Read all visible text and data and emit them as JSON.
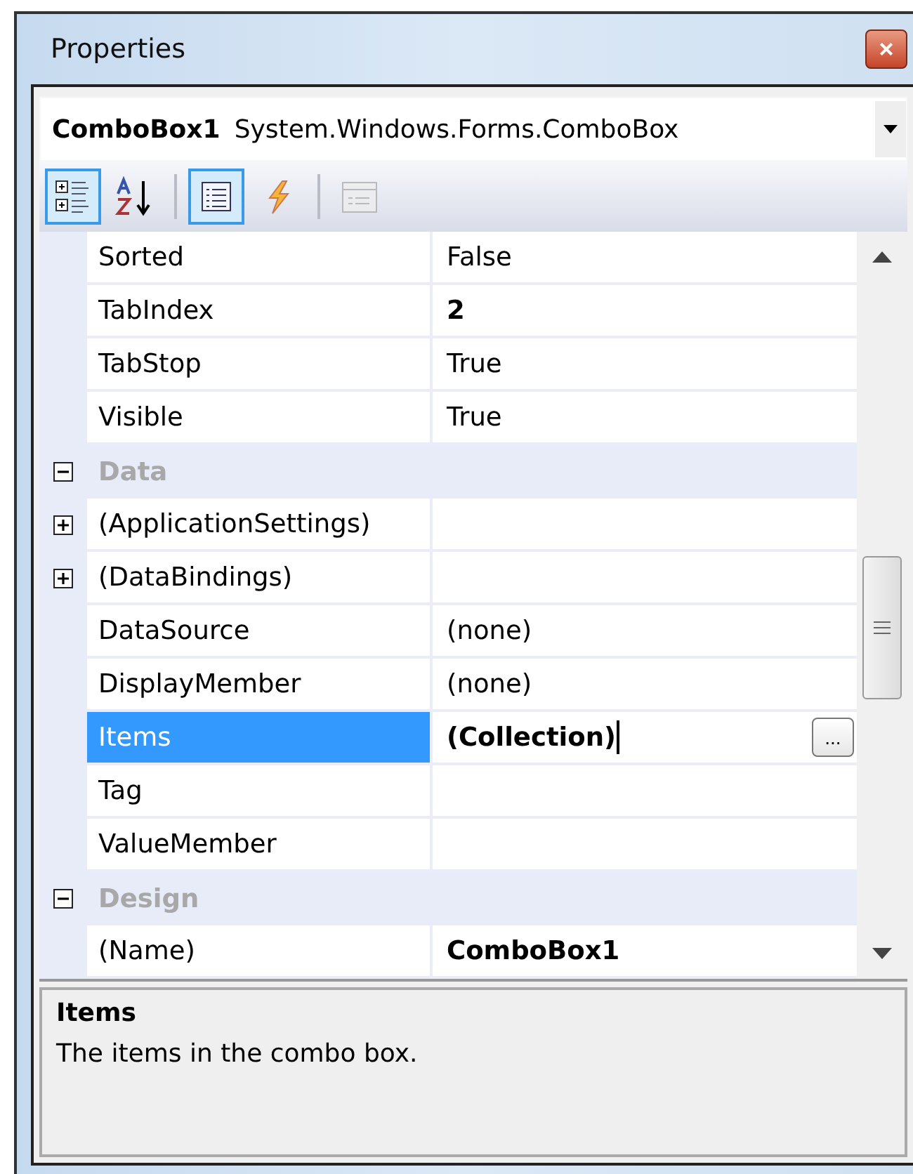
{
  "window": {
    "title": "Properties",
    "close": "×"
  },
  "object_selector": {
    "name": "ComboBox1",
    "type": "System.Windows.Forms.ComboBox"
  },
  "toolbar": [
    {
      "kind": "categorized",
      "selected": true,
      "disabled": false
    },
    {
      "kind": "alphabetical",
      "selected": false,
      "disabled": false
    },
    {
      "kind": "separator"
    },
    {
      "kind": "properties",
      "selected": true,
      "disabled": false
    },
    {
      "kind": "events",
      "selected": false,
      "disabled": false
    },
    {
      "kind": "separator"
    },
    {
      "kind": "property-pages",
      "selected": false,
      "disabled": true
    }
  ],
  "grid": {
    "rows": [
      {
        "kind": "property",
        "name": "Sorted",
        "value": "False",
        "bold": false,
        "selected": false
      },
      {
        "kind": "property",
        "name": "TabIndex",
        "value": "2",
        "bold": true,
        "selected": false
      },
      {
        "kind": "property",
        "name": "TabStop",
        "value": "True",
        "bold": false,
        "selected": false
      },
      {
        "kind": "property",
        "name": "Visible",
        "value": "True",
        "bold": false,
        "selected": false
      },
      {
        "kind": "category",
        "name": "Data",
        "expanded": true
      },
      {
        "kind": "property",
        "name": "(ApplicationSettings)",
        "value": "",
        "selected": false,
        "expanded": false
      },
      {
        "kind": "property",
        "name": "(DataBindings)",
        "value": "",
        "selected": false,
        "expanded": false
      },
      {
        "kind": "property",
        "name": "DataSource",
        "value": "(none)",
        "bold": false,
        "selected": false
      },
      {
        "kind": "property",
        "name": "DisplayMember",
        "value": "(none)",
        "bold": false,
        "selected": false
      },
      {
        "kind": "property",
        "name": "Items",
        "value": "(Collection)",
        "bold": true,
        "selected": true,
        "editor_button": "..."
      },
      {
        "kind": "property",
        "name": "Tag",
        "value": "",
        "selected": false
      },
      {
        "kind": "property",
        "name": "ValueMember",
        "value": "",
        "selected": false
      },
      {
        "kind": "category",
        "name": "Design",
        "expanded": true
      },
      {
        "kind": "property",
        "name": "(Name)",
        "value": "ComboBox1",
        "bold": true,
        "selected": false
      }
    ]
  },
  "description": {
    "title": "Items",
    "text": "The items in the combo box."
  }
}
